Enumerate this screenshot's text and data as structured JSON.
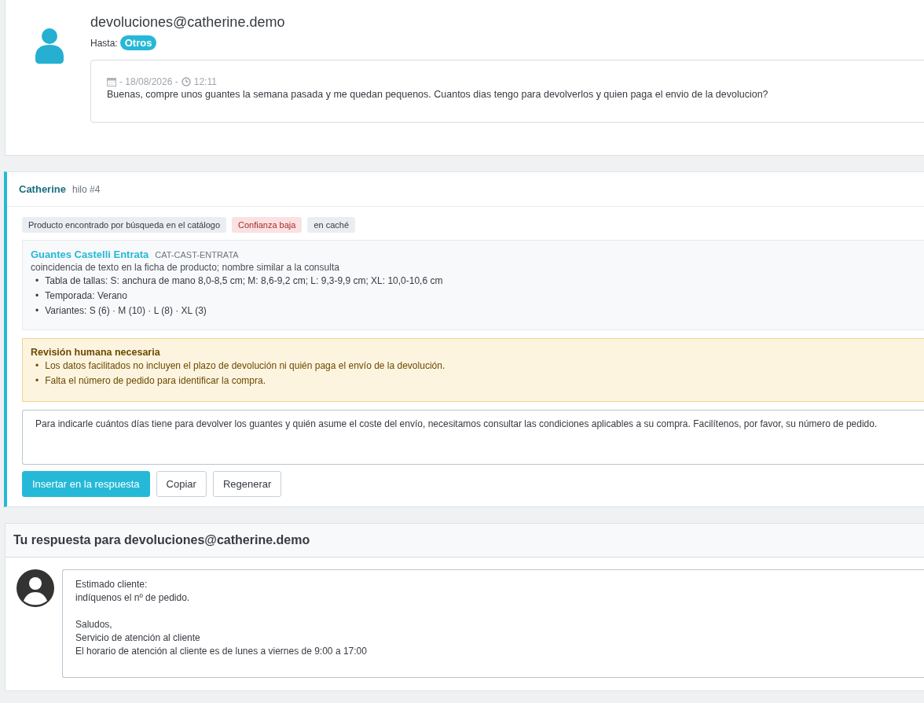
{
  "message": {
    "sender": "devoluciones@catherine.demo",
    "to_label": "Hasta:",
    "to_tag": "Otros",
    "date": "- 18/08/2026 -",
    "time": "12:11",
    "body": "Buenas, compre unos guantes la semana pasada y me quedan pequenos. Cuantos dias tengo para devolverlos y quien paga el envio de la devolucion?"
  },
  "assistant": {
    "name": "Catherine",
    "thread": "hilo #4",
    "tags": [
      {
        "label": "Producto encontrado por búsqueda en el catálogo",
        "kind": "neutral"
      },
      {
        "label": "Confianza baja",
        "kind": "danger"
      },
      {
        "label": "en caché",
        "kind": "neutral"
      }
    ],
    "bullet": "•",
    "product": {
      "name": "Guantes Castelli Entrata",
      "sku": "CAT-CAST-ENTRATA",
      "match": "coincidencia de texto en la ficha de producto; nombre similar a la consulta",
      "facts": [
        "Tabla de tallas: S: anchura de mano 8,0-8,5 cm; M: 8,6-9,2 cm; L: 9,3-9,9 cm; XL: 10,0-10,6 cm",
        "Temporada: Verano",
        "Variantes: S (6) · M (10) · L (8) · XL (3)"
      ]
    },
    "review": {
      "title": "Revisión humana necesaria",
      "items": [
        "Los datos facilitados no incluyen el plazo de devolución ni quién paga el envío de la devolución.",
        "Falta el número de pedido para identificar la compra."
      ]
    },
    "suggestion": "Para indicarle cuántos días tiene para devolver los guantes y quién asume el coste del envío, necesitamos consultar las condiciones aplicables a su compra. Facilítenos, por favor, su número de pedido.",
    "buttons": [
      {
        "label": "Insertar en la respuesta",
        "kind": "primary"
      },
      {
        "label": "Copiar",
        "kind": "default"
      },
      {
        "label": "Regenerar",
        "kind": "default"
      }
    ]
  },
  "reply": {
    "title": "Tu respuesta para devoluciones@catherine.demo",
    "body": "Estimado cliente:\nindíquenos el nº de pedido.\n\nSaludos,\nServicio de atención al cliente\nEl horario de atención al cliente es de lunes a viernes de 9:00 a 17:00"
  }
}
